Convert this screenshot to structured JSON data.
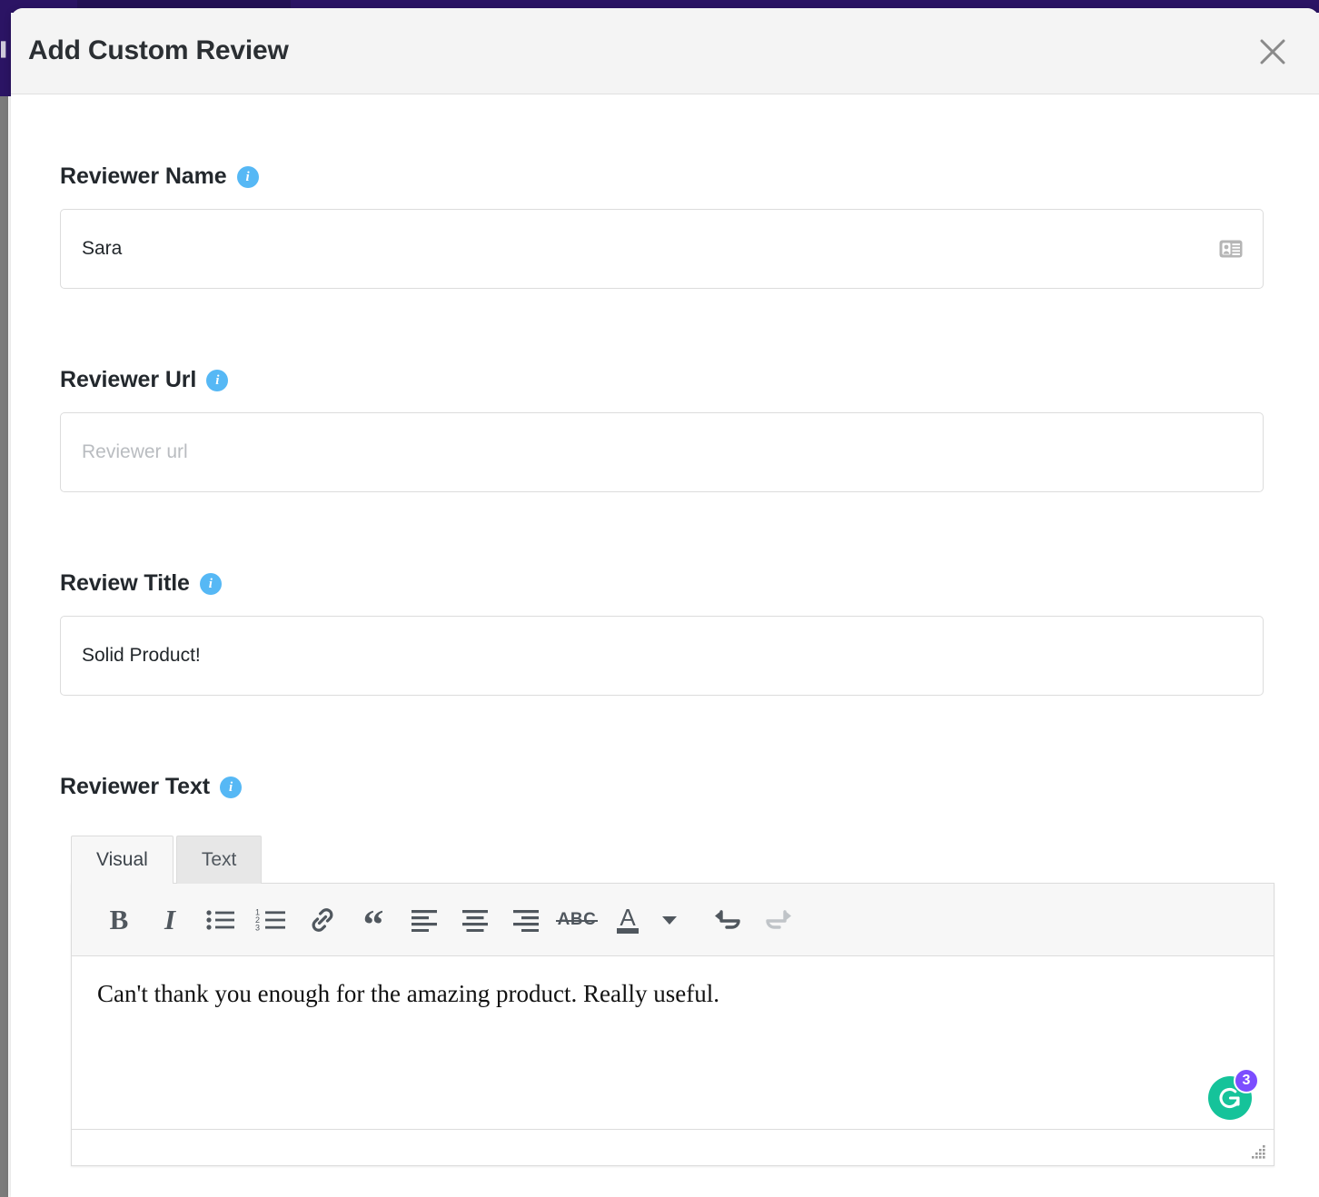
{
  "window": {
    "background_topbar_color": "#2B1464",
    "sidebar_glyph": "▌"
  },
  "modal": {
    "title": "Add Custom Review",
    "close_label": "×",
    "close_icon": "close-icon"
  },
  "fields": [
    {
      "label": "Reviewer Name",
      "info_icon": "info-icon",
      "info_glyph": "i",
      "value": "Sara",
      "placeholder": "",
      "trailing_icon": "contact-card-icon"
    },
    {
      "label": "Reviewer Url",
      "info_icon": "info-icon",
      "info_glyph": "i",
      "value": "",
      "placeholder": "Reviewer url",
      "trailing_icon": ""
    },
    {
      "label": "Review Title",
      "info_icon": "info-icon",
      "info_glyph": "i",
      "value": "Solid Product!",
      "placeholder": "",
      "trailing_icon": ""
    }
  ],
  "editor_section": {
    "label": "Reviewer Text",
    "info_glyph": "i",
    "tabs": [
      {
        "label": "Visual",
        "active": true
      },
      {
        "label": "Text",
        "active": false
      }
    ],
    "toolbar": [
      {
        "name": "bold-icon",
        "glyph": "B",
        "disabled": false
      },
      {
        "name": "italic-icon",
        "glyph": "I",
        "disabled": false
      },
      {
        "name": "bulleted-list-icon",
        "glyph": "",
        "disabled": false
      },
      {
        "name": "numbered-list-icon",
        "glyph": "",
        "disabled": false
      },
      {
        "name": "link-icon",
        "glyph": "",
        "disabled": false
      },
      {
        "name": "blockquote-icon",
        "glyph": "“",
        "disabled": false
      },
      {
        "name": "align-left-icon",
        "glyph": "",
        "disabled": false
      },
      {
        "name": "align-center-icon",
        "glyph": "",
        "disabled": false
      },
      {
        "name": "align-right-icon",
        "glyph": "",
        "disabled": false
      },
      {
        "name": "strikethrough-icon",
        "glyph": "ABC",
        "disabled": false
      },
      {
        "name": "text-color-icon",
        "glyph": "A",
        "disabled": false
      },
      {
        "name": "chevron-down-icon",
        "glyph": "",
        "disabled": false
      },
      {
        "name": "undo-icon",
        "glyph": "",
        "disabled": false
      },
      {
        "name": "redo-icon",
        "glyph": "",
        "disabled": true
      }
    ],
    "content": "Can't thank you enough for the amazing product. Really useful.",
    "grammarly": {
      "name": "grammarly-badge",
      "count": "3",
      "brand_color": "#15C39A",
      "badge_color": "#7C4DFF"
    },
    "resize_handle": "resize-handle"
  },
  "colors": {
    "accent_purple": "#2B1464",
    "info_blue": "#56B8F5",
    "border": "#DCDCDC",
    "header_bg": "#F4F4F4",
    "toolbar_bg": "#F7F7F7"
  }
}
